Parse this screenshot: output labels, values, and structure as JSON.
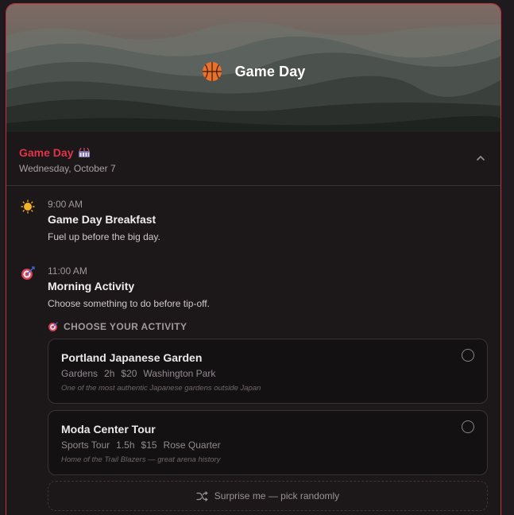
{
  "hero": {
    "title": "Game Day",
    "icon": "basketball-icon"
  },
  "section": {
    "title": "Game Day",
    "title_icon": "stadium-icon",
    "date": "Wednesday, October 7",
    "collapse_icon": "chevron-up-icon"
  },
  "events": [
    {
      "time": "9:00 AM",
      "name": "Game Day Breakfast",
      "description": "Fuel up before the big day.",
      "icon": "sun-icon"
    },
    {
      "time": "11:00 AM",
      "name": "Morning Activity",
      "description": "Choose something to do before tip-off.",
      "icon": "target-icon"
    }
  ],
  "activity_picker": {
    "label": "CHOOSE YOUR ACTIVITY",
    "options": [
      {
        "name": "Portland Japanese Garden",
        "category": "Gardens",
        "duration": "2h",
        "price": "$20",
        "location": "Washington Park",
        "note": "One of the most authentic Japanese gardens outside Japan",
        "selected": false
      },
      {
        "name": "Moda Center Tour",
        "category": "Sports Tour",
        "duration": "1.5h",
        "price": "$15",
        "location": "Rose Quarter",
        "note": "Home of the Trail Blazers — great arena history",
        "selected": false
      }
    ],
    "surprise_label": "Surprise me — pick randomly"
  },
  "colors": {
    "accent": "#e0344a",
    "border_accent": "#c7303f",
    "background": "#1c1719",
    "card": "#141113"
  }
}
